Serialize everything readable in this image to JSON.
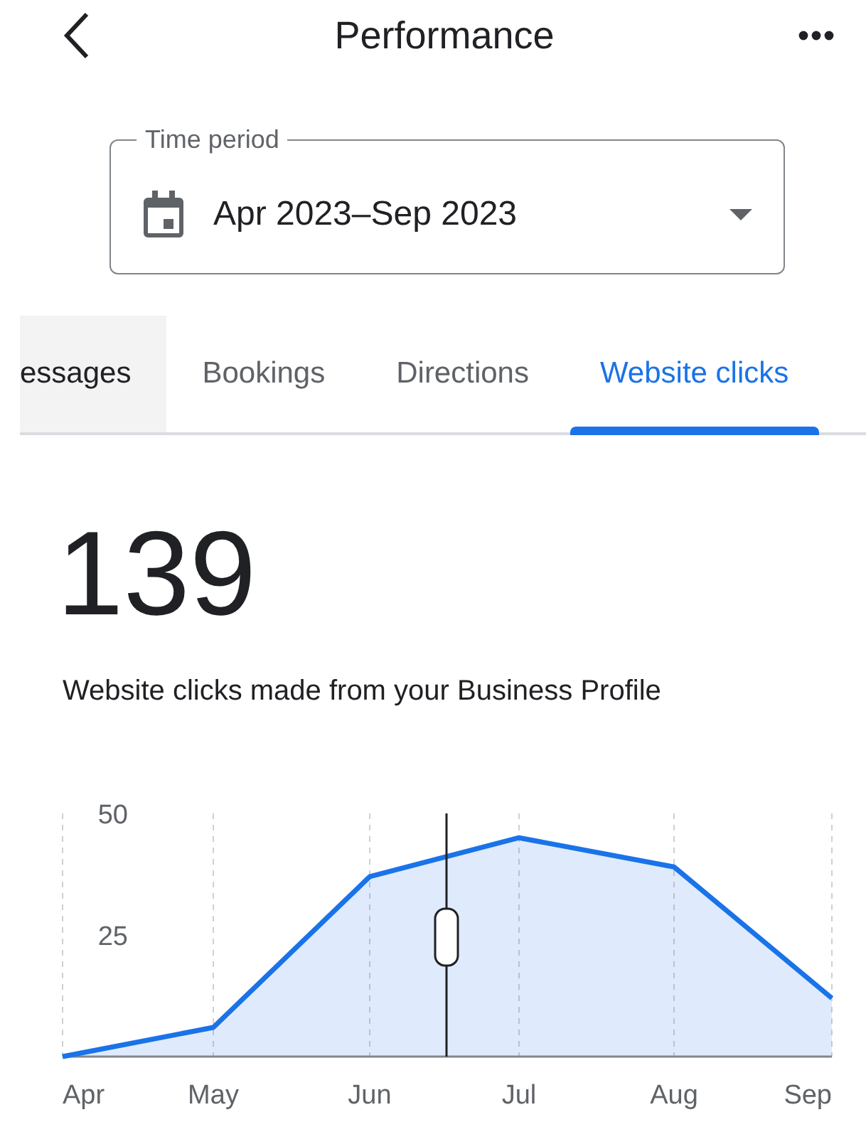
{
  "header": {
    "title": "Performance"
  },
  "time_period": {
    "label": "Time period",
    "value": "Apr 2023–Sep 2023"
  },
  "tabs": [
    {
      "label": "essages",
      "selected": false,
      "highlighted": true
    },
    {
      "label": "Bookings",
      "selected": false,
      "highlighted": false
    },
    {
      "label": "Directions",
      "selected": false,
      "highlighted": false
    },
    {
      "label": "Website clicks",
      "selected": true,
      "highlighted": false
    }
  ],
  "total": "139",
  "caption": "Website clicks made from your Business Profile",
  "chart": {
    "chart_data": {
      "type": "area",
      "categories": [
        "Apr",
        "May",
        "Jun",
        "Jul",
        "Aug",
        "Sep"
      ],
      "series": [
        {
          "color": "#1a73e8",
          "values": [
            0,
            6,
            37,
            45,
            39,
            12
          ]
        }
      ],
      "grid": true,
      "ylim": [
        0,
        50
      ],
      "yticks": [
        25,
        50
      ]
    }
  }
}
